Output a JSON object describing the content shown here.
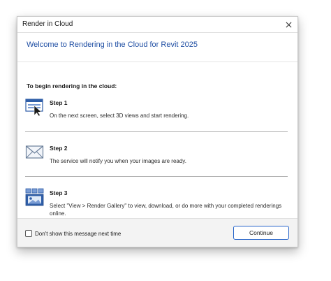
{
  "window": {
    "title": "Render in Cloud",
    "close_icon": "close-icon"
  },
  "header": {
    "welcome": "Welcome to Rendering in the Cloud for Revit 2025"
  },
  "intro": "To begin rendering in the cloud:",
  "steps": [
    {
      "title": "Step 1",
      "description": "On the next screen, select 3D views and start rendering.",
      "icon": "select-views-icon"
    },
    {
      "title": "Step 2",
      "description": "The service will notify you when your images are ready.",
      "icon": "envelope-icon"
    },
    {
      "title": "Step 3",
      "description": "Select \"View > Render Gallery\" to view, download, or do more with your completed renderings online.",
      "icon": "gallery-icon"
    }
  ],
  "footer": {
    "checkbox_label": "Don't show this message next time",
    "checkbox_checked": false,
    "continue_label": "Continue"
  },
  "colors": {
    "accent_text": "#1f4ea3",
    "button_border": "#2563c9",
    "icon_blue": "#2f5ea8"
  }
}
